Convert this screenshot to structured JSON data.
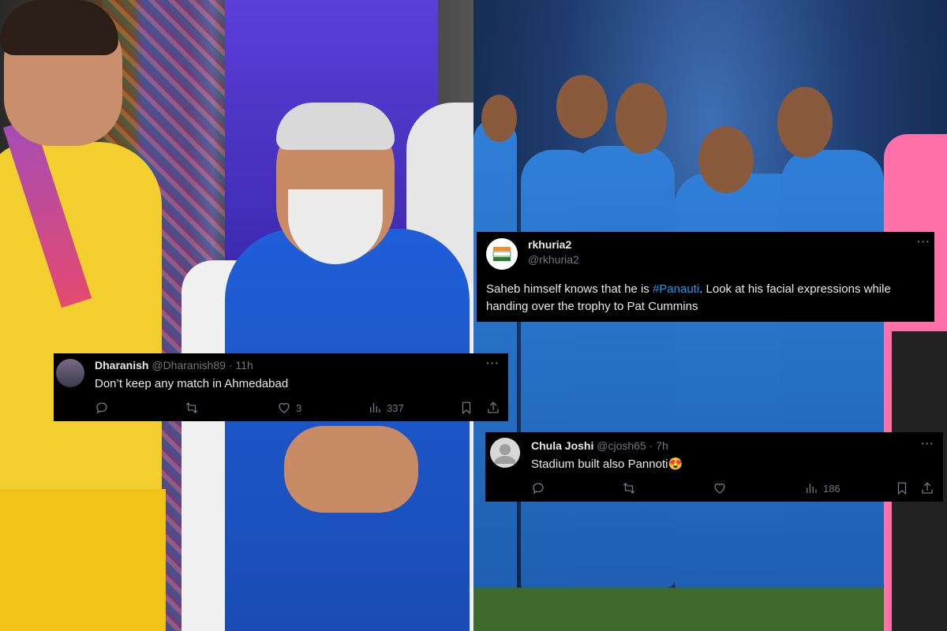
{
  "tweets": {
    "left": {
      "name": "Dharanish",
      "handle": "@Dharanish89",
      "time": "· 11h",
      "text": "Don’t keep any match in Ahmedabad",
      "likes": "3",
      "views": "337",
      "more": "···"
    },
    "top_right": {
      "name": "rkhuria2",
      "handle": "@rkhuria2",
      "more": "···",
      "text_before": "Saheb himself knows that he is ",
      "hashtag": "#Panauti",
      "text_after": ". Look at his facial expressions while handing over the trophy to Pat Cummins"
    },
    "bottom_right": {
      "name": "Chula Joshi",
      "handle": "@cjosh65",
      "time": "· 7h",
      "text": "Stadium built also Pannoti😍",
      "views": "186",
      "more": "···"
    }
  },
  "icons": [
    "reply-icon",
    "retweet-icon",
    "like-icon",
    "views-icon",
    "bookmark-icon",
    "share-icon"
  ],
  "colors": {
    "tweet_bg": "#000000",
    "text": "#e7e9ea",
    "muted": "#71767b",
    "link": "#1d9bf0"
  }
}
